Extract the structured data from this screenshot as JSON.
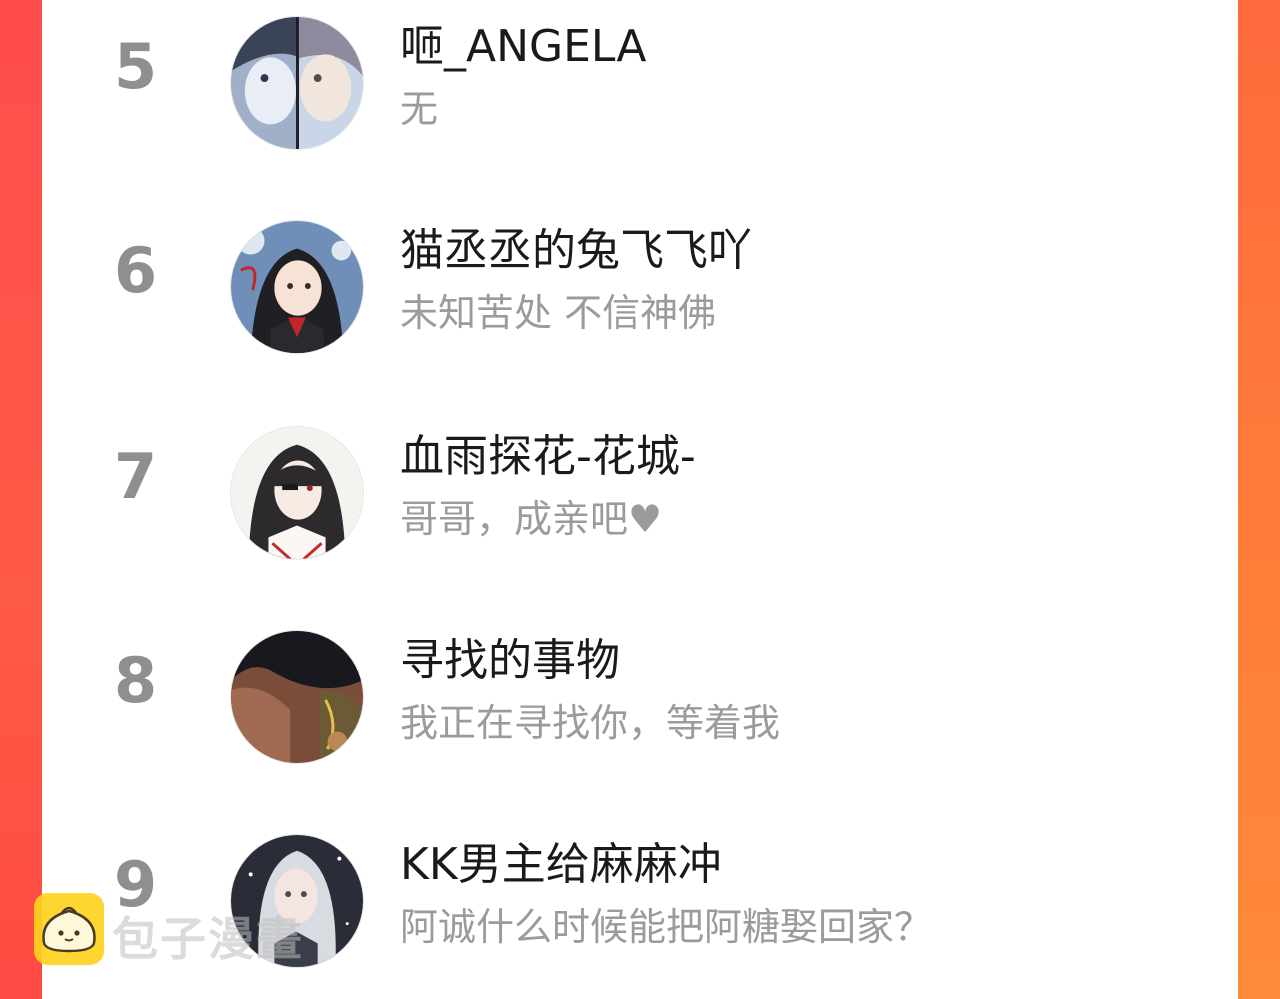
{
  "colors": {
    "frame_left": "#ff4d4d",
    "frame_right": "#ff7d3a",
    "rank_text": "#8f8f8f",
    "name_text": "#1a1a1a",
    "sign_text": "#9b9b9b"
  },
  "ranking": [
    {
      "rank": "5",
      "name": "咂_ANGELA",
      "signature": "无",
      "avatar": "anime-avatar"
    },
    {
      "rank": "6",
      "name": "猫丞丞的兔飞飞吖",
      "signature": "未知苦处 不信神佛",
      "avatar": "anime-avatar"
    },
    {
      "rank": "7",
      "name": "血雨探花-花城-",
      "signature": "哥哥，成亲吧♥",
      "avatar": "anime-avatar"
    },
    {
      "rank": "8",
      "name": "寻找的事物",
      "signature": "我正在寻找你，等着我",
      "avatar": "anime-avatar"
    },
    {
      "rank": "9",
      "name": "KK男主给麻麻冲",
      "signature": "阿诚什么时候能把阿糖娶回家？",
      "avatar": "anime-avatar"
    }
  ],
  "watermark": {
    "text": "包子漫畫",
    "logo_icon": "bun-mascot-icon"
  }
}
